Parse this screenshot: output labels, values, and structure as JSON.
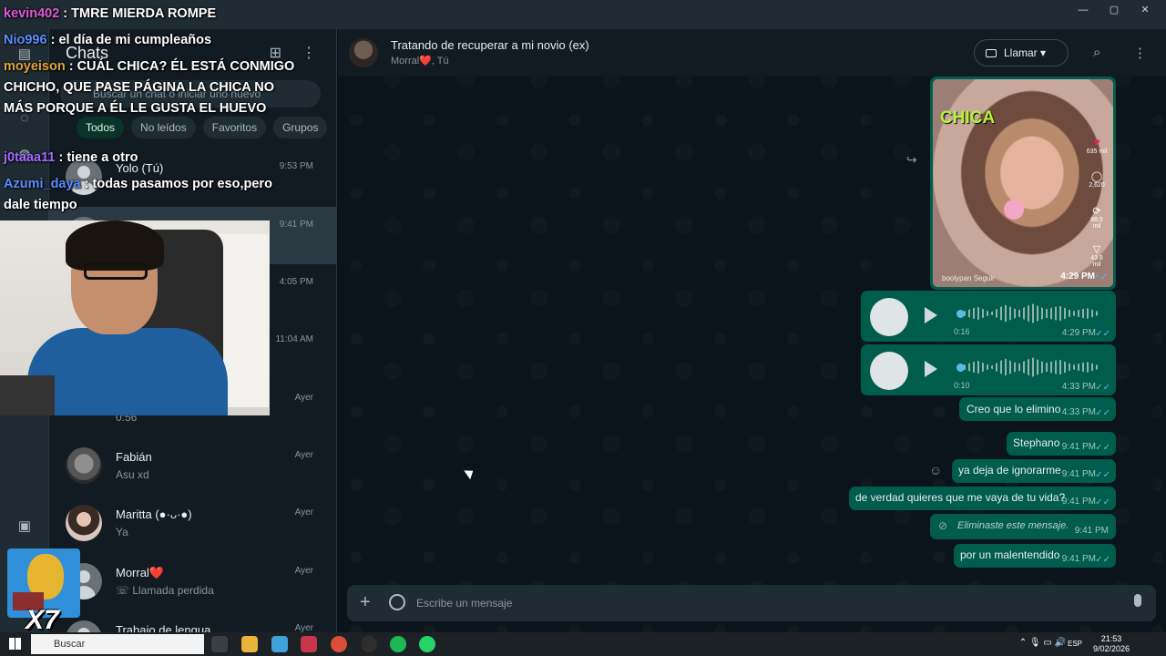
{
  "window": {
    "minimize": "—",
    "maximize": "▢",
    "close": "✕"
  },
  "chat_list": {
    "title": "Chats",
    "search_placeholder": "Buscar un chat o iniciar uno nuevo",
    "filters": [
      "Todos",
      "No leídos",
      "Favoritos",
      "Grupos"
    ],
    "rows": [
      {
        "name": "Yolo (Tú)",
        "preview": "",
        "time": "9:53 PM"
      },
      {
        "name": "",
        "preview": "",
        "time": "9:41 PM"
      },
      {
        "name": "",
        "preview": "",
        "time": "4:05 PM"
      },
      {
        "name": "",
        "preview": "",
        "time": "11:04 AM"
      },
      {
        "name": "",
        "preview": "0:56",
        "time": "Ayer"
      },
      {
        "name": "Fabián",
        "preview": "Asu xd",
        "time": "Ayer"
      },
      {
        "name": "Maritta (●·ᴗ·●)",
        "preview": "Ya",
        "time": "Ayer"
      },
      {
        "name": "Morral❤️",
        "preview": "Llamada perdida",
        "time": "Ayer"
      },
      {
        "name": "Trabajo de lengua",
        "preview": "",
        "time": "Ayer"
      }
    ]
  },
  "header": {
    "title": "Tratando de recuperar a mi novio (ex)",
    "subtitle_name": "Morral",
    "subtitle_heart": "❤️",
    "subtitle_rest": ", Tú",
    "call_label": "Llamar"
  },
  "post": {
    "overlay_text": "CHICA",
    "likes": "635 mil",
    "comments": "2,620",
    "reposts": "88.5 mil",
    "shares": "43.8 mil",
    "user": "boolypan  Seguir",
    "time": "4:29 PM"
  },
  "voice_messages": [
    {
      "duration": "0:16",
      "time": "4:29 PM"
    },
    {
      "duration": "0:10",
      "time": "4:33 PM"
    }
  ],
  "messages": [
    {
      "text": "Creo que lo elimino",
      "time": "4:33 PM"
    },
    {
      "text": "Stephano",
      "time": "9:41 PM"
    },
    {
      "text": "ya deja de ignorarme",
      "time": "9:41 PM"
    },
    {
      "text": "de verdad quieres que me vaya de tu vida?",
      "time": "9:41 PM"
    },
    {
      "text": "Eliminaste este mensaje.",
      "time": "9:41 PM"
    },
    {
      "text": "por un malentendido",
      "time": "9:41 PM"
    }
  ],
  "compose": {
    "placeholder": "Escribe un mensaje"
  },
  "stream_chat": [
    {
      "user": "kevin402",
      "user_color": "#e05ad6",
      "text": " : TMRE MIERDA ROMPE"
    },
    {
      "user": "Nio996",
      "user_color": "#5b8dff",
      "text": " : el día de mi cumpleaños"
    },
    {
      "user": "moyeison",
      "user_color": "#e0a340",
      "text": " : CUÁL CHICA? ÉL ESTÁ CONMIGO CHICHO, QUE PASE PÁGINA LA CHICA NO MÁS PORQUE A ÉL LE GUSTA EL HUEVO"
    },
    {
      "user": "j0taaa11",
      "user_color": "#a36bff",
      "text": " : tiene a otro"
    },
    {
      "user": "Azumi_daya",
      "user_color": "#5b8dff",
      "text": " : todas pasamos por eso,pero dale tiempo"
    }
  ],
  "overlay_badge": "X7",
  "taskbar": {
    "search": "Buscar",
    "lang": "ESP",
    "time": "21:53",
    "date": "9/02/2026"
  },
  "colors": {
    "bubble": "#005c4b",
    "background": "#0b141a",
    "panel": "#111b21",
    "read_ticks": "#53bdeb"
  }
}
